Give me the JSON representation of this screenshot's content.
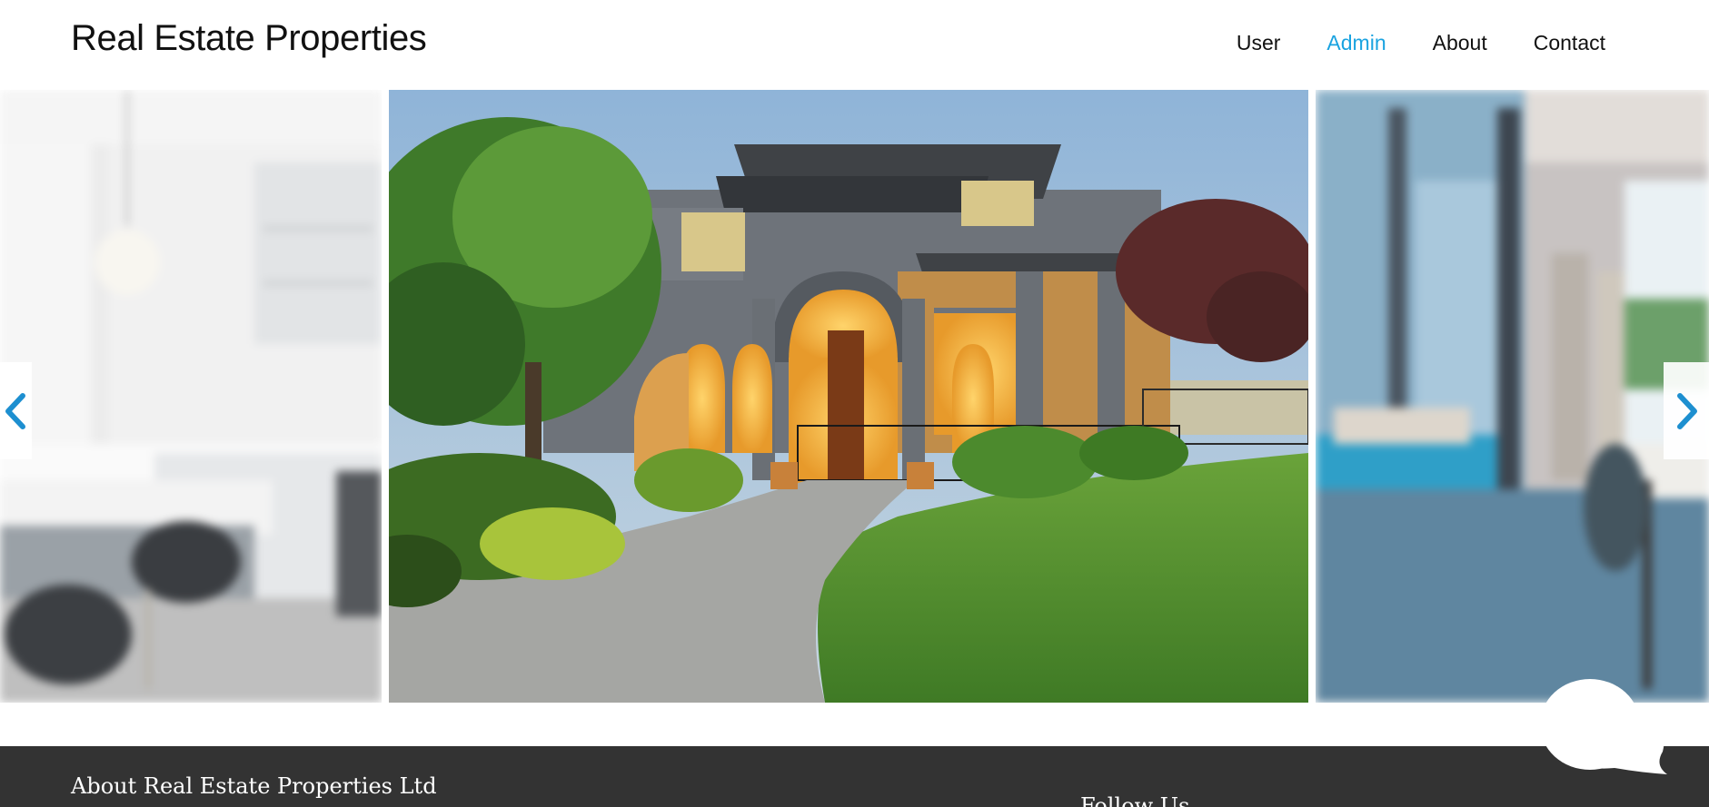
{
  "header": {
    "brand": "Real Estate Properties",
    "nav": [
      {
        "label": "User",
        "active": false
      },
      {
        "label": "Admin",
        "active": true
      },
      {
        "label": "About",
        "active": false
      },
      {
        "label": "Contact",
        "active": false
      }
    ]
  },
  "carousel": {
    "slides": [
      {
        "subject": "white kitchen interior",
        "state": "blurred-previous"
      },
      {
        "subject": "house exterior at dusk",
        "state": "active"
      },
      {
        "subject": "dining room with glass doors",
        "state": "blurred-next"
      }
    ],
    "prev_icon": "chevron-left-icon",
    "next_icon": "chevron-right-icon"
  },
  "footer": {
    "about_heading": "About Real Estate Properties Ltd",
    "follow_heading": "Follow Us"
  },
  "chat": {
    "icon": "chat-bubble-icon"
  },
  "colors": {
    "accent": "#1aa3e0",
    "footer_bg": "#333333"
  }
}
